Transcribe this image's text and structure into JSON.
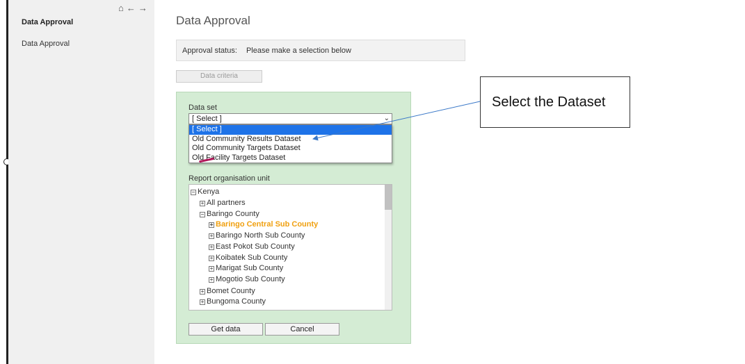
{
  "sidebar": {
    "heading": "Data Approval",
    "link": "Data Approval",
    "icons": [
      "home-icon",
      "back-arrow-icon",
      "forward-arrow-icon"
    ]
  },
  "page": {
    "title": "Data Approval",
    "status_label": "Approval status:",
    "status_value": "Please make a selection below",
    "criteria_tab": "Data criteria"
  },
  "form": {
    "dataset_label": "Data set",
    "dataset_selected": "[ Select ]",
    "dataset_options": [
      "[ Select ]",
      "Old Community Results Dataset",
      "Old Community Targets Dataset",
      "Old Facility Targets Dataset"
    ],
    "orgunit_label": "Report organisation unit",
    "tree": [
      {
        "label": "Kenya",
        "toggle": "−"
      },
      {
        "label": "All partners",
        "toggle": "+"
      },
      {
        "label": "Baringo County",
        "toggle": "−"
      },
      {
        "label": "Baringo Central Sub County",
        "toggle": "+",
        "highlighted": true
      },
      {
        "label": "Baringo North Sub County",
        "toggle": "+"
      },
      {
        "label": "East Pokot Sub County",
        "toggle": "+"
      },
      {
        "label": "Koibatek Sub County",
        "toggle": "+"
      },
      {
        "label": "Marigat Sub County",
        "toggle": "+"
      },
      {
        "label": "Mogotio Sub County",
        "toggle": "+"
      },
      {
        "label": "Bomet County",
        "toggle": "+"
      },
      {
        "label": "Bungoma County",
        "toggle": "+"
      }
    ],
    "get_data": "Get data",
    "cancel": "Cancel"
  },
  "annotation": {
    "callout": "Select the Dataset"
  },
  "colors": {
    "panel": "#d4ecd4",
    "selected_option": "#1e73e8",
    "highlight_node": "#f0a010",
    "arrow": "#3a78c8"
  }
}
